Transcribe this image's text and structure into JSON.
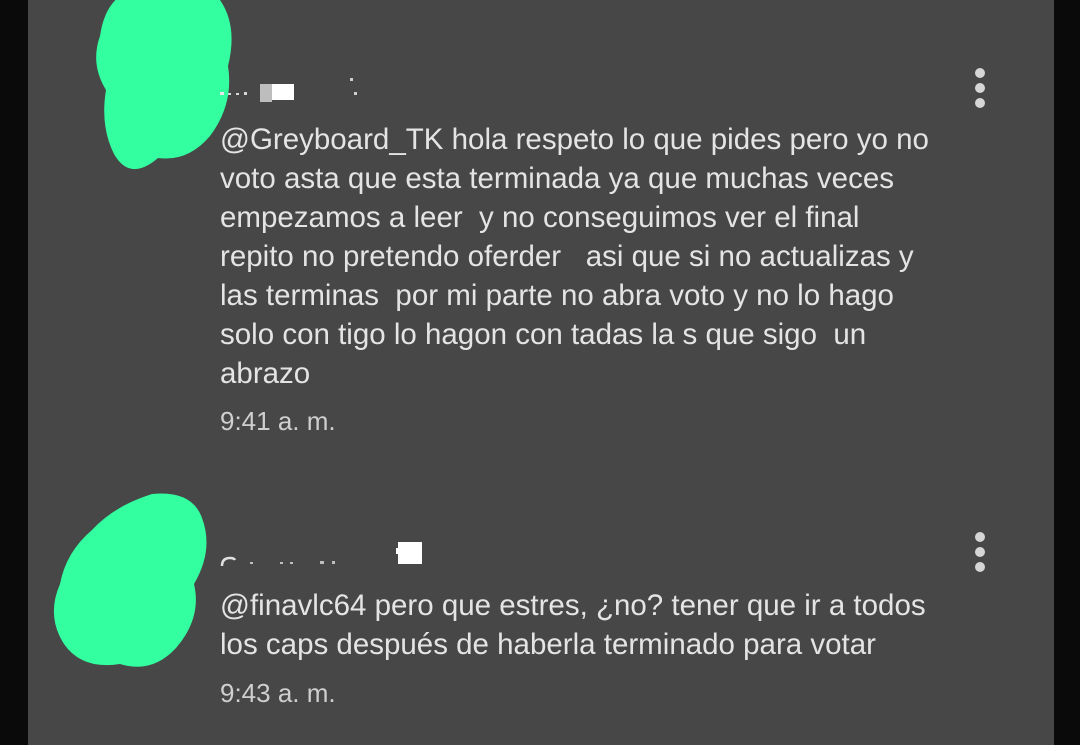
{
  "colors": {
    "panel_bg": "#474747",
    "outer_bg": "#0a0a0a",
    "text": "#e4e4e4",
    "timestamp": "#cfcfcf",
    "avatar_scribble": "#33ffa0"
  },
  "comments": [
    {
      "mention": "@Greyboard_TK",
      "text": " hola respeto lo que pides pero yo no\nvoto asta que esta terminada ya que muchas veces\nempezamos a leer  y no conseguimos ver el final\nrepito no pretendo oferder   asi que si no actualizas y\nlas terminas  por mi parte no abra voto y no lo hago\nsolo con tigo lo hagon con tadas la s que sigo  un\nabrazo",
      "timestamp": "9:41 a. m.",
      "menu_icon": "more-vertical-icon"
    },
    {
      "mention": "@finavlc64",
      "text": " pero que estres, ¿no? tener que ir a todos\nlos caps después de haberla terminado para votar",
      "timestamp": "9:43 a. m.",
      "menu_icon": "more-vertical-icon"
    }
  ]
}
